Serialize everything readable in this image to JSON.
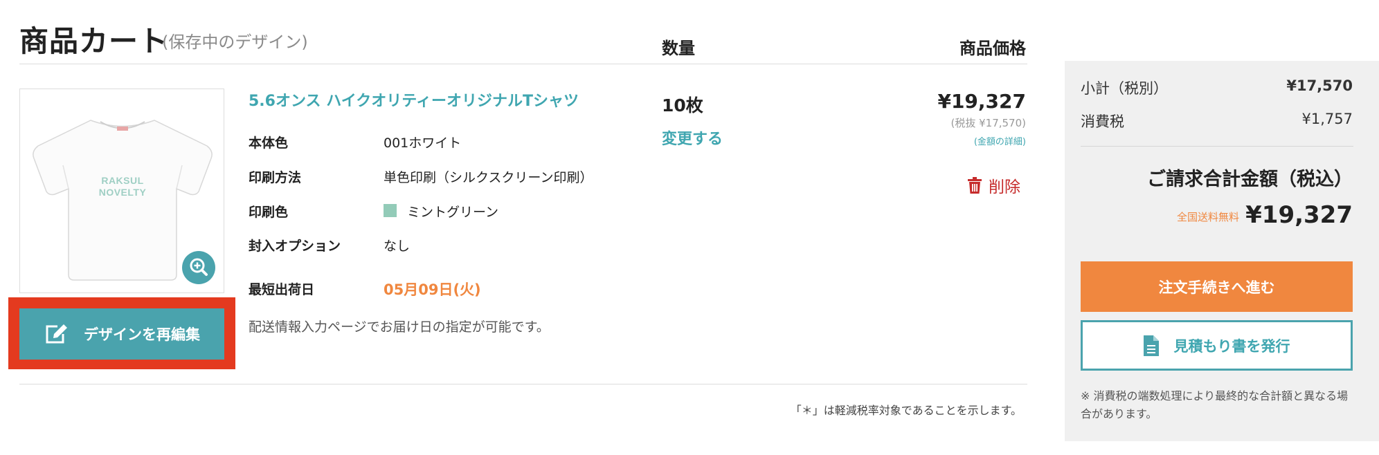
{
  "header": {
    "title": "商品カート",
    "subtitle": "(保存中のデザイン)",
    "quantity_col": "数量",
    "price_col": "商品価格"
  },
  "product": {
    "image_print_lines": [
      "RAKSUL",
      "NOVELTY"
    ],
    "name": "5.6オンス ハイクオリティーオリジナルTシャツ",
    "specs": [
      {
        "label": "本体色",
        "value": "001ホワイト"
      },
      {
        "label": "印刷方法",
        "value": "単色印刷（シルクスクリーン印刷）"
      },
      {
        "label": "印刷色",
        "value": "ミントグリーン",
        "swatch": "#93cbb8"
      },
      {
        "label": "封入オプション",
        "value": "なし"
      }
    ],
    "ship_label": "最短出荷日",
    "ship_date": "05月09日(火)",
    "ship_note": "配送情報入力ページでお届け日の指定が可能です。",
    "redesign_label": "デザインを再編集",
    "zoom_icon": "zoom-in-icon"
  },
  "quantity": {
    "value": "10枚",
    "change_label": "変更する"
  },
  "price": {
    "amount": "¥19,327",
    "excl_tax": "(税抜 ¥17,570)",
    "detail_link": "(金額の詳細)",
    "delete_label": "削除"
  },
  "footnote": "「＊」は軽減税率対象であることを示します。",
  "summary": {
    "subtotal_label": "小計（税別）",
    "subtotal_value": "¥17,570",
    "tax_label": "消費税",
    "tax_value": "¥1,757",
    "total_title": "ご請求合計金額（税込）",
    "free_shipping": "全国送料無料",
    "total_value": "¥19,327",
    "order_button": "注文手続きへ進む",
    "quote_button": "見積もり書を発行",
    "note": "※ 消費税の端数処理により最終的な合計額と異なる場合があります。"
  },
  "colors": {
    "accent": "#4aa3ad",
    "orange": "#f0873f",
    "delete_red": "#c62c2c",
    "highlight_red": "#e43a1f"
  }
}
